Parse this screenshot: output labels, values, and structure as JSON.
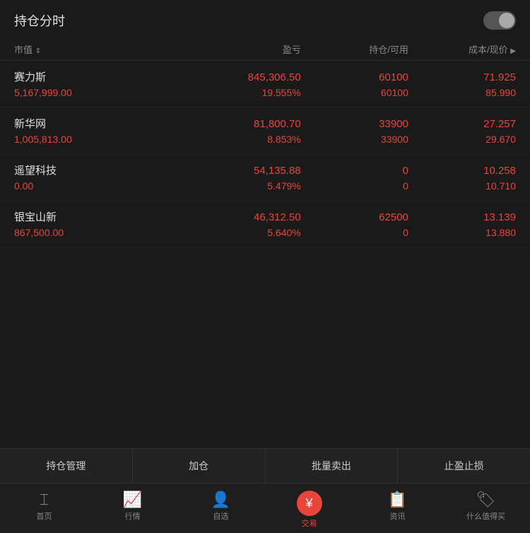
{
  "header": {
    "title": "持仓分时"
  },
  "columns": {
    "market_value": "市值",
    "pnl": "盈亏",
    "position": "持仓/可用",
    "cost": "成本/现价"
  },
  "stocks": [
    {
      "name": "赛力斯",
      "market_value": "5,167,999.00",
      "pnl_amount": "845,306.50",
      "pnl_pct": "19.555%",
      "position": "60100",
      "available": "60100",
      "cost": "71.925",
      "current": "85.990"
    },
    {
      "name": "新华网",
      "market_value": "1,005,813.00",
      "pnl_amount": "81,800.70",
      "pnl_pct": "8.853%",
      "position": "33900",
      "available": "33900",
      "cost": "27.257",
      "current": "29.670"
    },
    {
      "name": "遥望科技",
      "market_value": "0.00",
      "pnl_amount": "54,135.88",
      "pnl_pct": "5.479%",
      "position": "0",
      "available": "0",
      "cost": "10.258",
      "current": "10.710"
    },
    {
      "name": "银宝山新",
      "market_value": "867,500.00",
      "pnl_amount": "46,312.50",
      "pnl_pct": "5.640%",
      "position": "62500",
      "available": "0",
      "cost": "13.139",
      "current": "13.880"
    }
  ],
  "action_bar": {
    "manage": "持仓管理",
    "add": "加仓",
    "sell": "批量卖出",
    "profit_stop": "止盈止损"
  },
  "nav": {
    "home": "首页",
    "market": "行情",
    "watchlist": "自选",
    "trade": "交易",
    "news": "资讯",
    "value": "什么值得买"
  }
}
